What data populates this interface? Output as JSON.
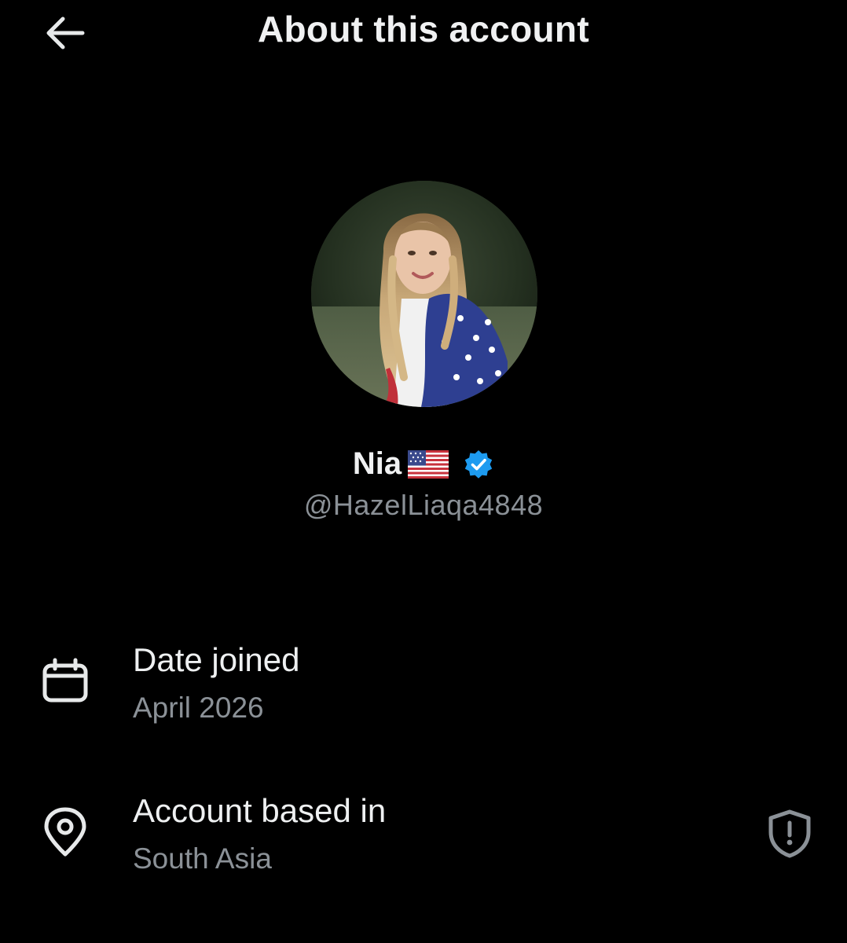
{
  "header": {
    "title": "About this account",
    "back_icon": "arrow-left-icon"
  },
  "profile": {
    "display_name": "Nia",
    "flag": "US flag emoji",
    "verified_color": "#1d9bf0",
    "handle": "@HazelLiaqa4848"
  },
  "details": [
    {
      "icon": "calendar-icon",
      "label": "Date joined",
      "value": "April 2026"
    },
    {
      "icon": "location-pin-icon",
      "label": "Account based in",
      "value": "South Asia",
      "action_icon": "shield-alert-icon"
    }
  ],
  "colors": {
    "background": "#000000",
    "primary_text": "#e7e9ea",
    "secondary_text": "#8b9197",
    "accent": "#1d9bf0"
  }
}
